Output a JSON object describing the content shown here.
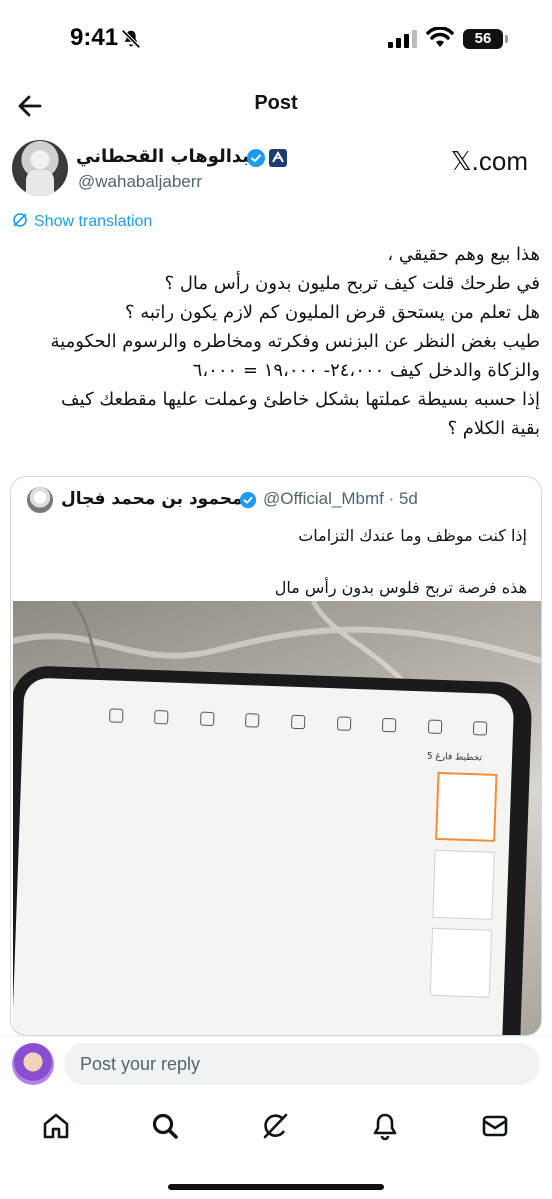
{
  "status_bar": {
    "time": "9:41",
    "battery": "56"
  },
  "header": {
    "title": "Post"
  },
  "author": {
    "name": "عبدالوهاب القحطاني",
    "handle": "@wahabaljaberr",
    "source_brand": "𝕏.com"
  },
  "translate_label": "Show translation",
  "tweet_lines": [
    "هذا بيع وهم حقيقي ،",
    "في طرحك قلت كيف تربح مليون بدون رأس مال ؟",
    "هل تعلم من يستحق قرض المليون كم لازم يكون راتبه ؟",
    "طيب بغض النظر عن البزنس وفكرته ومخاطره والرسوم الحكومية",
    "والزكاة والدخل كيف ٢٤،٠٠٠- ١٩،٠٠٠ = ٦،٠٠٠",
    "إذا حسبه بسيطة عملتها بشكل خاطئ وعملت عليها مقطعك كيف",
    "بقية الكلام ؟"
  ],
  "quote": {
    "name": "محمود بن محمد فجال",
    "handle_time": "@Official_Mbmf · 5d",
    "lines": [
      "إذا كنت موظف وما عندك التزامات",
      "",
      "هذه فرصة تربح فلوس بدون رأس مال"
    ],
    "media": {
      "doc_tab_label": "تخطيط فارغ 5"
    }
  },
  "reply": {
    "placeholder": "Post your reply"
  },
  "tabs": [
    "home-icon",
    "search-icon",
    "grok-icon",
    "notifications-icon",
    "messages-icon"
  ],
  "colors": {
    "accent": "#1d9bf0",
    "text": "#0f1419",
    "muted": "#536471"
  }
}
